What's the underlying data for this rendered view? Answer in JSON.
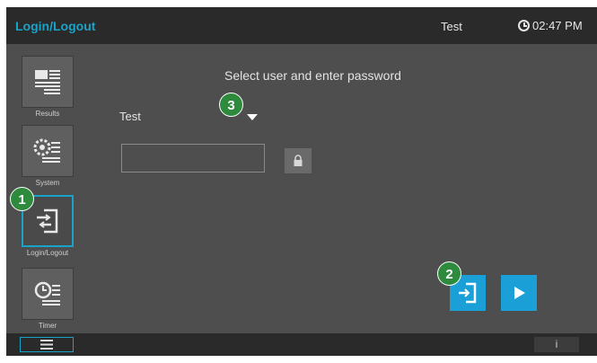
{
  "header": {
    "title": "Login/Logout",
    "user": "Test",
    "time": "02:47 PM"
  },
  "sidebar": {
    "items": [
      {
        "label": "Results",
        "icon": "results-icon"
      },
      {
        "label": "System",
        "icon": "system-icon"
      },
      {
        "label": "Login/Logout",
        "icon": "login-logout-icon",
        "active": true
      },
      {
        "label": "Timer",
        "icon": "timer-icon"
      }
    ]
  },
  "main": {
    "heading": "Select user and enter password",
    "selected_user": "Test",
    "password_value": "",
    "password_placeholder": ""
  },
  "callouts": [
    "1",
    "2",
    "3"
  ],
  "footer": {
    "info": "i"
  },
  "colors": {
    "accent": "#1aa3c8",
    "action": "#1a9fd6",
    "callout": "#2e8b3e"
  }
}
